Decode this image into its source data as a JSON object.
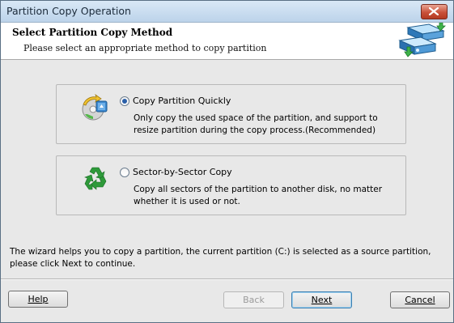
{
  "window": {
    "title": "Partition Copy Operation"
  },
  "header": {
    "title": "Select Partition Copy Method",
    "subtitle": "Please select an appropriate method to copy partition",
    "icon": "disk-copy-icon"
  },
  "options": [
    {
      "label": "Copy Partition Quickly",
      "description": "Only copy the used space of the partition, and support to resize partition during the copy process.(Recommended)",
      "selected": true,
      "icon": "quick-copy-icon"
    },
    {
      "label": "Sector-by-Sector Copy",
      "description": "Copy all sectors of the partition to another disk, no matter whether it is used or not.",
      "selected": false,
      "icon": "recycle-icon"
    }
  ],
  "wizard_note": "The wizard helps you to copy a partition, the current partition (C:) is selected as a source partition, please click Next to continue.",
  "buttons": {
    "help": "Help",
    "back": "Back",
    "next": "Next",
    "cancel": "Cancel"
  },
  "colors": {
    "accent": "#2a5fa8",
    "recycle_green": "#2e9a3a"
  }
}
